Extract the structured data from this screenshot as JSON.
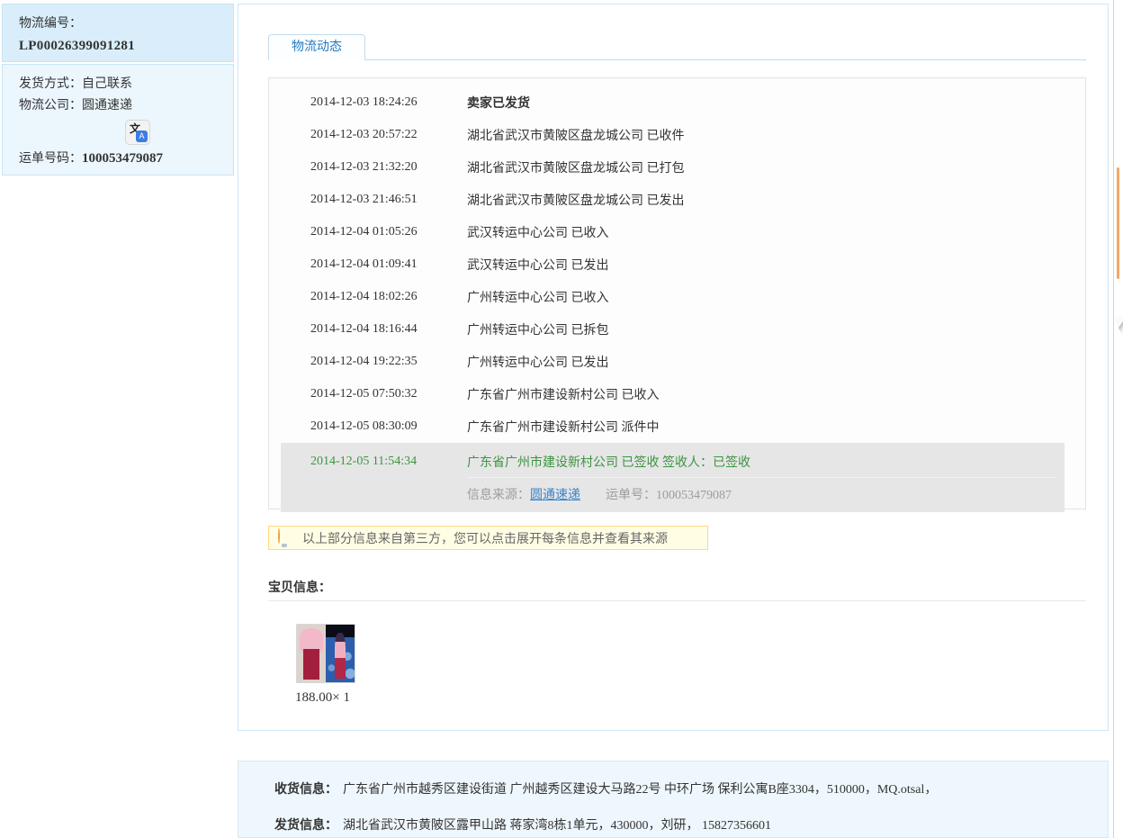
{
  "sidebar": {
    "logistics_no_label": "物流编号：",
    "logistics_no_value": "LP00026399091281",
    "shipping_method_label": "发货方式：",
    "shipping_method_value": "自己联系",
    "company_label": "物流公司：",
    "company_value": "圆通速递",
    "translate_icon_wen": "文",
    "translate_icon_a": "A",
    "waybill_label": "运单号码：",
    "waybill_value": "100053479087"
  },
  "main": {
    "tab_label": "物流动态",
    "timeline": [
      {
        "time": "2014-12-03 18:24:26",
        "desc": "卖家已发货",
        "bold": true
      },
      {
        "time": "2014-12-03 20:57:22",
        "desc": "湖北省武汉市黄陂区盘龙城公司 已收件"
      },
      {
        "time": "2014-12-03 21:32:20",
        "desc": "湖北省武汉市黄陂区盘龙城公司 已打包"
      },
      {
        "time": "2014-12-03 21:46:51",
        "desc": "湖北省武汉市黄陂区盘龙城公司 已发出"
      },
      {
        "time": "2014-12-04 01:05:26",
        "desc": "武汉转运中心公司 已收入"
      },
      {
        "time": "2014-12-04 01:09:41",
        "desc": "武汉转运中心公司 已发出"
      },
      {
        "time": "2014-12-04 18:02:26",
        "desc": "广州转运中心公司 已收入"
      },
      {
        "time": "2014-12-04 18:16:44",
        "desc": "广州转运中心公司 已拆包"
      },
      {
        "time": "2014-12-04 19:22:35",
        "desc": "广州转运中心公司 已发出"
      },
      {
        "time": "2014-12-05 07:50:32",
        "desc": "广东省广州市建设新村公司 已收入"
      },
      {
        "time": "2014-12-05 08:30:09",
        "desc": "广东省广州市建设新村公司 派件中"
      },
      {
        "time": "2014-12-05 11:54:34",
        "desc": "广东省广州市建设新村公司 已签收 签收人：已签收",
        "highlight": true,
        "source_label": "信息来源：",
        "source_link": "圆通速递",
        "source_waybill": "运单号：100053479087"
      }
    ],
    "tip_text": "以上部分信息来自第三方，您可以点击展开每条信息并查看其来源",
    "item_section_title": "宝贝信息：",
    "item_price": "188.00× 1"
  },
  "footer": {
    "receiver_label": "收货信息：",
    "receiver_value": "广东省广州市越秀区建设街道 广州越秀区建设大马路22号 中环广场 保利公寓B座3304，510000，MQ.otsal，",
    "sender_label": "发货信息：",
    "sender_value": "湖北省武汉市黄陂区露甲山路 蒋家湾8栋1单元，430000，刘研，  15827356601"
  },
  "colors": {
    "sidebar_top_bg": "#d9eefa",
    "sidebar_bottom_bg": "#ecf6fd",
    "box_border_blue": "#cfe7f5",
    "tab_text": "#2579c0",
    "signed_green": "#3c9442",
    "highlight_gray": "#e6e6e6",
    "link_blue": "#3a84c8",
    "tip_bg": "#fffee5",
    "tip_border": "#ffd685",
    "scroll_thumb_orange": "#f2aa63"
  }
}
